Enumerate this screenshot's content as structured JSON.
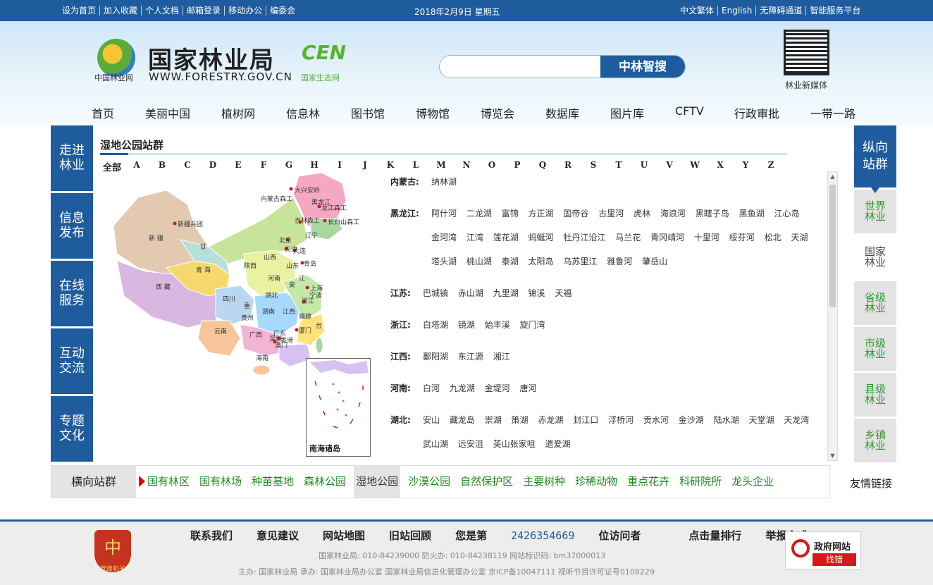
{
  "topbar": {
    "links": [
      "设为首页",
      "加入收藏",
      "个人文档",
      "邮箱登录",
      "移动办公",
      "编委会"
    ],
    "date": "2018年2月9日  星期五",
    "right_links": [
      "中文繁体",
      "English",
      "无障碍通道",
      "智能服务平台"
    ]
  },
  "header": {
    "logo_sub": "中国林业网",
    "logo_title": "国家林业局",
    "logo_url": "WWW.FORESTRY.GOV.CN",
    "eco_mark": "CEN",
    "eco_sub": "国家生态网",
    "search_placeholder": "",
    "search_button": "中林智搜",
    "qr_label": "林业新媒体"
  },
  "nav": [
    "首页",
    "美丽中国",
    "植树网",
    "信息林",
    "图书馆",
    "博物馆",
    "博览会",
    "数据库",
    "图片库",
    "CFTV",
    "行政审批",
    "一带一路"
  ],
  "left_sidebar": [
    [
      "走进",
      "林业"
    ],
    [
      "信息",
      "发布"
    ],
    [
      "在线",
      "服务"
    ],
    [
      "互动",
      "交流"
    ],
    [
      "专题",
      "文化"
    ]
  ],
  "content": {
    "title": "湿地公园站群",
    "all": "全部",
    "letters": [
      "A",
      "B",
      "C",
      "D",
      "E",
      "F",
      "G",
      "H",
      "I",
      "J",
      "K",
      "L",
      "M",
      "N",
      "O",
      "P",
      "Q",
      "R",
      "S",
      "T",
      "U",
      "V",
      "W",
      "X",
      "Y",
      "Z"
    ],
    "inset_label": "南海诸岛",
    "map_labels": {
      "daxinganling": "大兴安岭",
      "neimenggu_forest": "内蒙古森工",
      "heilongjiang": "黑龙江",
      "longjiang": "龙江森工",
      "jilin_forest": "吉林森工",
      "changbaishan": "长白山森工",
      "xinjiang_corps": "新疆兵团",
      "xinjiang": "新  疆",
      "xizang": "西  藏",
      "qinghai": "青  海",
      "gansu": "甘",
      "sichuan": "四川",
      "yunnan": "云南",
      "guangxi": "广西",
      "hainan": "海南",
      "beijing": "北京",
      "tianjin": "天津",
      "dalian": "大连",
      "qingdao": "青岛",
      "ningbo": "宁波",
      "xiamen": "厦门",
      "shenzhen": "深圳",
      "hongkong": "香港",
      "macau": "澳门",
      "shanghai": "上海",
      "hubei": "湖北",
      "hunan": "湖南",
      "jiangxi": "江西",
      "henan": "河南",
      "shanxi": "山西",
      "shaanxi": "陕西",
      "liaoning": "辽宁",
      "guizhou": "贵州",
      "guangdong": "广东",
      "fujian": "福建",
      "zhejiang": "浙江",
      "anhui": "安",
      "jiangsu": "江",
      "shandong": "山东",
      "chongqing": "重",
      "taiwan": "台"
    },
    "regions": [
      {
        "name": "内蒙古:",
        "lakes": [
          "纳林湖"
        ]
      },
      {
        "name": "黑龙江:",
        "lakes": [
          "阿什河",
          "二龙湖",
          "富锦",
          "方正湖",
          "固帝谷",
          "古里河",
          "虎林",
          "海浪河",
          "黑瞎子岛",
          "黑鱼湖",
          "江心岛",
          "金河湾",
          "江湾",
          "莲花湖",
          "蚂蜒河",
          "牡丹江沿江",
          "马兰花",
          "青冈靖河",
          "十里河",
          "绥芬河",
          "松北",
          "天湖",
          "塔头湖",
          "桃山湖",
          "泰湖",
          "太阳岛",
          "乌苏里江",
          "雅鲁河",
          "肇岳山"
        ]
      },
      {
        "name": "江苏:",
        "lakes": [
          "巴城镇",
          "赤山湖",
          "九里湖",
          "锦溪",
          "天福"
        ]
      },
      {
        "name": "浙江:",
        "lakes": [
          "白塔湖",
          "镜湖",
          "始丰溪",
          "旋门湾"
        ]
      },
      {
        "name": "江西:",
        "lakes": [
          "鄱阳湖",
          "东江源",
          "湘江"
        ]
      },
      {
        "name": "河南:",
        "lakes": [
          "白河",
          "九龙湖",
          "金堤河",
          "唐河"
        ]
      },
      {
        "name": "湖北:",
        "lakes": [
          "安山",
          "藏龙岛",
          "崇湖",
          "策湖",
          "赤龙湖",
          "封江口",
          "浮桥河",
          "贡水河",
          "金沙湖",
          "陆水湖",
          "天堂湖",
          "天龙湾",
          "武山湖",
          "远安沮",
          "英山张家咀",
          "遗爱湖"
        ]
      }
    ]
  },
  "right_sidebar": {
    "head": [
      "纵向",
      "站群"
    ],
    "items": [
      {
        "label": [
          "世界",
          "林业"
        ],
        "selected": false
      },
      {
        "label": [
          "国家",
          "林业"
        ],
        "selected": true
      },
      {
        "label": [
          "省级",
          "林业"
        ],
        "selected": false
      },
      {
        "label": [
          "市级",
          "林业"
        ],
        "selected": false
      },
      {
        "label": [
          "县级",
          "林业"
        ],
        "selected": false
      },
      {
        "label": [
          "乡镇",
          "林业"
        ],
        "selected": false
      }
    ]
  },
  "hbar": {
    "label": "横向站群",
    "links": [
      "国有林区",
      "国有林场",
      "种苗基地",
      "森林公园",
      "湿地公园",
      "沙漠公园",
      "自然保护区",
      "主要树种",
      "珍稀动物",
      "重点花卉",
      "科研院所",
      "龙头企业"
    ],
    "selected": "湿地公园",
    "friend": "友情链接"
  },
  "footer": {
    "emblem_char": "中",
    "emblem_sub": "党政机关",
    "links": [
      "联系我们",
      "意见建议",
      "网站地图",
      "旧站回顾"
    ],
    "visit_prefix": "您是第",
    "visit_count": "2426354669",
    "visit_suffix": "位访问者",
    "links2": [
      "点击量排行",
      "举报方式"
    ],
    "line1": "国家林业局: 010-84239000  防火办: 010-84238119  网站标识码: bm37000013",
    "line2": "主办: 国家林业局  承办: 国家林业局办公室  国家林业局信息化管理办公室  京ICP备10047111  视听节目许可证号0108229",
    "gov_title": "政府网站",
    "gov_button": "找错"
  },
  "colors": {
    "primary": "#1e5c9e",
    "green_link": "#1a8a1a",
    "accent_red": "#d51a1a"
  }
}
